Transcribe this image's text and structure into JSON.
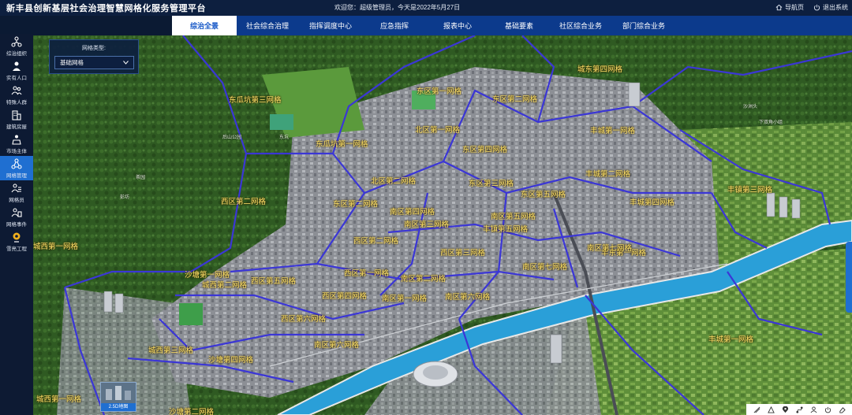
{
  "header": {
    "title": "新丰县创新基层社会治理智慧网格化服务管理平台",
    "welcome": "欢迎您：超级管理员，今天是2022年5月27日",
    "nav_link": "导航页",
    "logout": "退出系统"
  },
  "nav": {
    "tabs": [
      {
        "label": "综治全景",
        "active": true
      },
      {
        "label": "社会综合治理"
      },
      {
        "label": "指挥调度中心"
      },
      {
        "label": "应急指挥"
      },
      {
        "label": "报表中心"
      },
      {
        "label": "基础要素"
      },
      {
        "label": "社区综合业务"
      },
      {
        "label": "部门综合业务"
      }
    ]
  },
  "sidebar": {
    "items": [
      {
        "label": "综治组织",
        "icon": "org-icon"
      },
      {
        "label": "实有人口",
        "icon": "person-icon"
      },
      {
        "label": "特殊人群",
        "icon": "people-icon"
      },
      {
        "label": "建筑房屋",
        "icon": "building-icon"
      },
      {
        "label": "市场主体",
        "icon": "market-icon"
      },
      {
        "label": "网格管理",
        "icon": "grid-icon",
        "active": true
      },
      {
        "label": "网格员",
        "icon": "worker-icon"
      },
      {
        "label": "网格事件",
        "icon": "event-icon"
      },
      {
        "label": "雪亮工程",
        "icon": "camera-icon"
      }
    ]
  },
  "panel": {
    "label": "网格类型:",
    "selected": "基础网格"
  },
  "map": {
    "grid_labels": [
      "城东第四网格",
      "东瓜坑第三网格",
      "东区第一网格",
      "东区第二网格",
      "东瓜坑第一网格",
      "丰城第一网格",
      "丰城第二网格",
      "北区第一网格",
      "北区第二网格",
      "东区第四网格",
      "东区第三网格",
      "西区第二网格",
      "丰镇第三网格",
      "东区第二网格",
      "东区第五网格",
      "南区第四网格",
      "南区第三网格",
      "南区第五网格",
      "丰城第四网格",
      "丰镇第五网格",
      "西区第二网格",
      "丰东第一网格",
      "西区第三网格",
      "沙塘第一网格",
      "城西第一网格",
      "城西第二网格",
      "西区第五网格",
      "西区第一网格",
      "南区第二网格",
      "西区第四网格",
      "南区第一网格",
      "南区第六网格",
      "南区第七网格",
      "西区第六网格",
      "城西第三网格",
      "沙塘第四网格",
      "南区第六网格",
      "南区第七网格",
      "丰城第一网格",
      "城西第一网格",
      "沙塘第二网格"
    ],
    "place_labels": [
      "后山公园",
      "东坑",
      "沙洲头",
      "下双角小组",
      "茶园",
      "彭坊"
    ],
    "thumbnail_label": "2.5D地图"
  },
  "colors": {
    "header_bg": "#0d1f3f",
    "nav_bg": "#0c3a8c",
    "accent": "#1f6fd1",
    "grid_line": "#3b36d6",
    "grid_label": "#ffe36b",
    "river": "#2a9fd8"
  }
}
